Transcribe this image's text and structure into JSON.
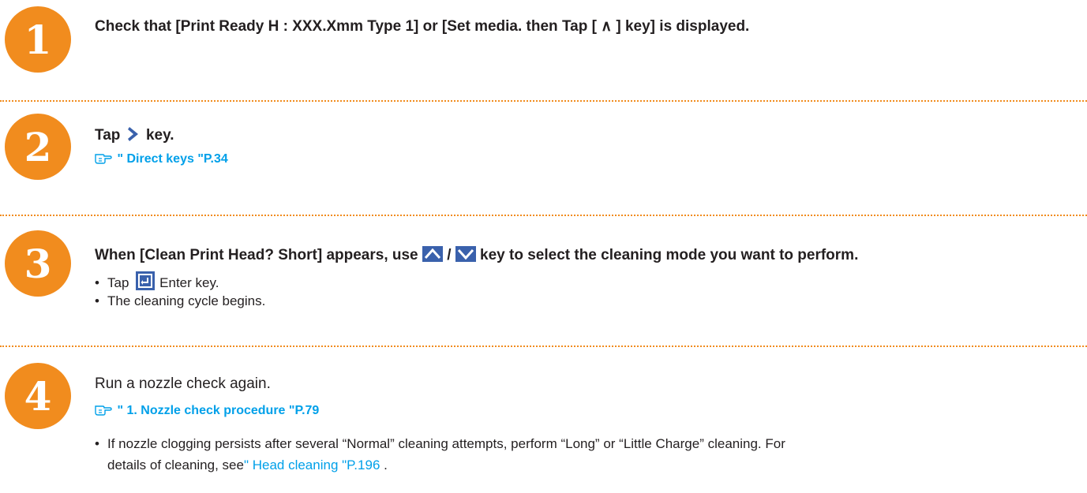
{
  "steps": [
    {
      "number": "1",
      "heading": "Check that [Print Ready H : XXX.Xmm Type 1] or [Set media. then Tap  [ ∧ ] key] is displayed."
    },
    {
      "number": "2",
      "heading_before": "Tap",
      "heading_after": "key.",
      "ref_text": "\" Direct keys \"P.34"
    },
    {
      "number": "3",
      "heading_before": "When [Clean Print Head? Short] appears, use",
      "heading_sep": "/",
      "heading_after": "key to select the cleaning mode you want to perform.",
      "bullets": [
        {
          "before": "Tap",
          "after": "Enter key."
        },
        {
          "text": "The cleaning cycle begins."
        }
      ]
    },
    {
      "number": "4",
      "heading": "Run a nozzle check again.",
      "ref_text": "\" 1. Nozzle check procedure \"P.79",
      "note_line1": "If nozzle clogging persists after several “Normal” cleaning attempts, perform “Long” or “Little Charge” cleaning. For",
      "note_line2_before": "details of cleaning, see",
      "note_line2_link": "\" Head cleaning \"P.196",
      "note_line2_after": " ."
    }
  ],
  "bullet_char": "•",
  "colors": {
    "accent": "#f18c1e",
    "link": "#00a0e9",
    "key_blue": "#3a61ac",
    "text": "#231f20"
  },
  "icons": {
    "reference": "pointing-hand-icon",
    "right_key": "right-arrow-key-icon",
    "up_key": "up-arrow-key-icon",
    "down_key": "down-arrow-key-icon",
    "enter_key": "enter-key-icon"
  }
}
